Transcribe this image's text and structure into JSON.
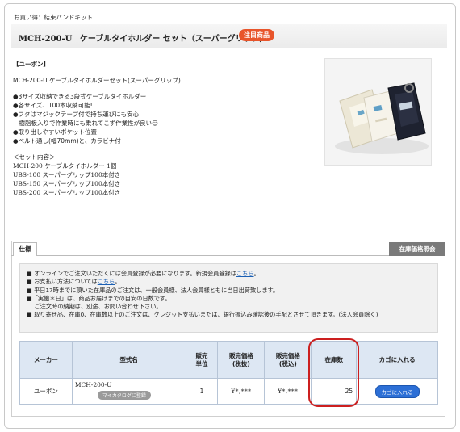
{
  "breadcrumb": "お買い得：結束バンドキット",
  "product": {
    "code": "MCH-200-U",
    "name": "ケーブルタイホルダー セット（スーパーグリップ）",
    "badge": "注目商品"
  },
  "description": {
    "brand": "【ユーボン】",
    "headline": "MCH-200-U ケーブルタイホルダーセット(スーパーグリップ)",
    "features": [
      "●3サイズ収納できる3段式ケーブルタイホルダー",
      "●各サイズ、100本収納可能!",
      "●フタはマジックテープ付で持ち運びにも安心!",
      "　樹脂板入りで作業時にも乗れてこず作業性が良い☺",
      "●取り出しやすいポケット位置",
      "●ベルト通し(幅70mm)と、カラビナ付"
    ],
    "set_heading": "＜セット内容＞",
    "set_items": [
      "MCH-200 ケーブルタイホルダー 1個",
      "UBS-100 スーパーグリップ100本付き",
      "UBS-150 スーパーグリップ100本付き",
      "UBS-200 スーパーグリップ100本付き"
    ]
  },
  "tabs": {
    "spec": "仕様",
    "stock": "在庫価格照会"
  },
  "notice": {
    "line1_pre": "■ オンラインでご注文いただくには会員登録が必要になります。新規会員登録は",
    "line1_link": "こちら",
    "line1_post": "。",
    "line2_pre": "■ お支払い方法については",
    "line2_link": "こちら",
    "line2_post": "。",
    "line3": "■ 平日17時までに頂いた在庫品のご注文は、一般会員様、法人会員様ともに当日出荷致します。",
    "line4": "■「実働＊日」は、商品お届けまでの目安の日数です。",
    "line5": "　 ご注文時の納期は、別途、お問い合わせ下さい。",
    "line6": "■ 取り寄せ品、在庫0、在庫数以上のご注文は、クレジット支払いまたは、銀行振込み確認後の手配とさせて頂きます。(法人会員除く)"
  },
  "table": {
    "headers": {
      "maker": "メーカー",
      "model": "型式名",
      "unit": "販売単位",
      "price_ex": "販売価格(税抜)",
      "price_in": "販売価格(税込)",
      "stock": "在庫数",
      "cart": "カゴに入れる"
    },
    "row": {
      "maker": "ユーボン",
      "model": "MCH-200-U",
      "catalog_button": "マイカタログに登録",
      "unit": "1",
      "price_ex": "¥*,***",
      "price_in": "¥*,***",
      "stock": "25",
      "cart_button": "カゴに入れる"
    }
  },
  "colors": {
    "badge": "#e8552b",
    "header_bg": "#dde7f3",
    "highlight": "#cc1f1f",
    "cart_button": "#2c6fd6",
    "link": "#1a5fb4"
  }
}
